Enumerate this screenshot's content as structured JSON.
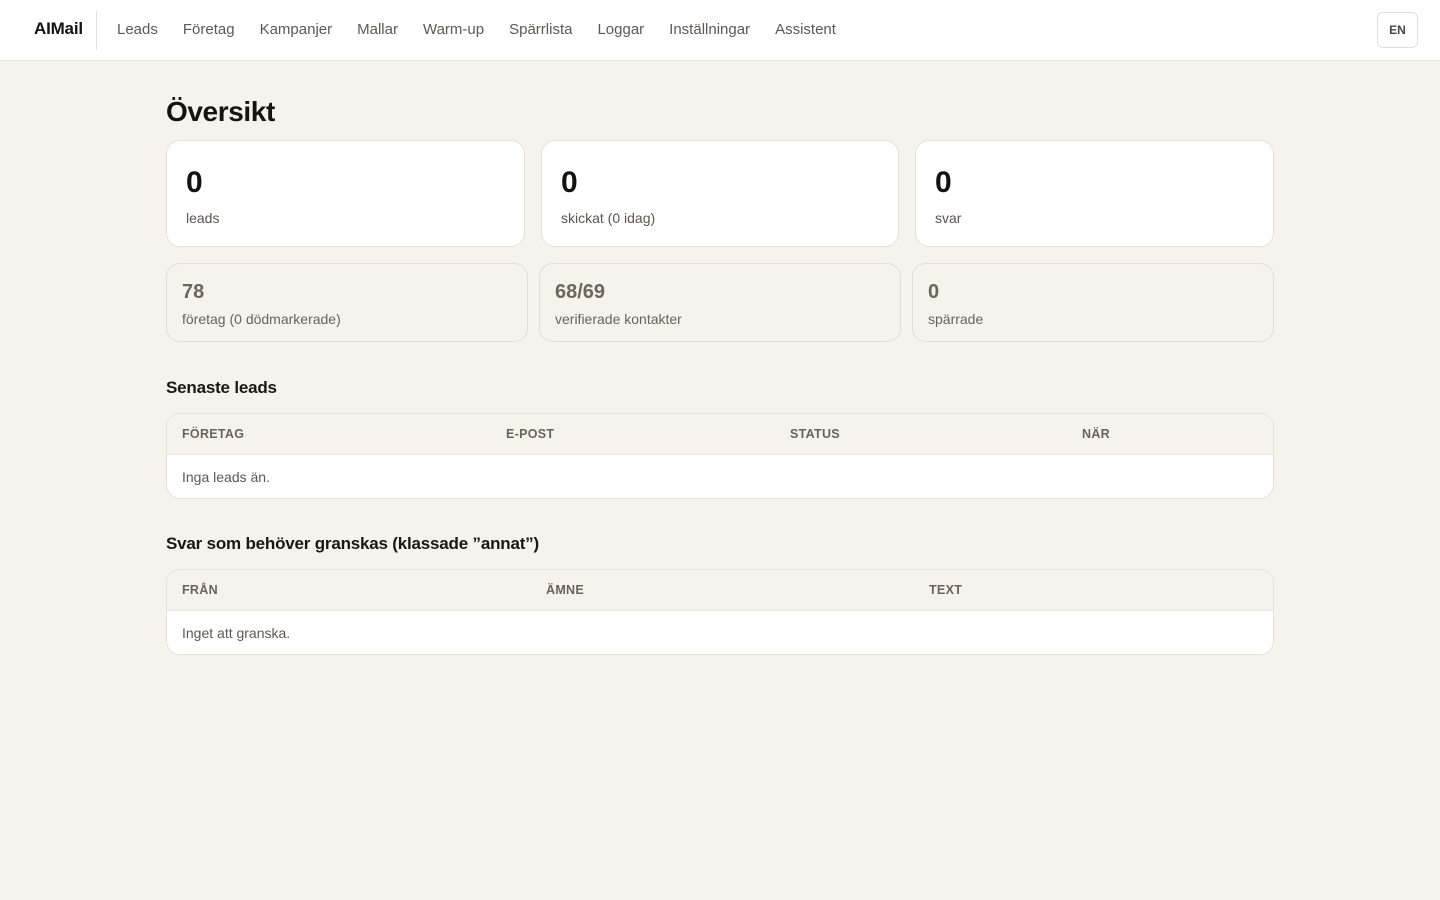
{
  "app": {
    "brand": "AIMail",
    "nav": [
      "Leads",
      "Företag",
      "Kampanjer",
      "Mallar",
      "Warm-up",
      "Spärrlista",
      "Loggar",
      "Inställningar",
      "Assistent"
    ],
    "language_button": "EN"
  },
  "page": {
    "title": "Översikt"
  },
  "stats": [
    {
      "value": "0",
      "label": "leads"
    },
    {
      "value": "0",
      "label": "skickat (0 idag)"
    },
    {
      "value": "0",
      "label": "svar"
    }
  ],
  "substats": [
    {
      "value": "78",
      "label": "företag (0 dödmarkerade)"
    },
    {
      "value": "68/69",
      "label": "verifierade kontakter"
    },
    {
      "value": "0",
      "label": "spärrade"
    }
  ],
  "recent_leads": {
    "title": "Senaste leads",
    "columns": [
      "FÖRETAG",
      "E-POST",
      "STATUS",
      "NÄR"
    ],
    "empty_text": "Inga leads än."
  },
  "review_replies": {
    "title": "Svar som behöver granskas (klassade ”annat”)",
    "columns": [
      "FRÅN",
      "ÄMNE",
      "TEXT"
    ],
    "empty_text": "Inget att granska."
  },
  "colors": {
    "background": "#f6f3ed",
    "card": "#ffffff",
    "text": "#1c1a17",
    "muted": "#6a635a"
  }
}
